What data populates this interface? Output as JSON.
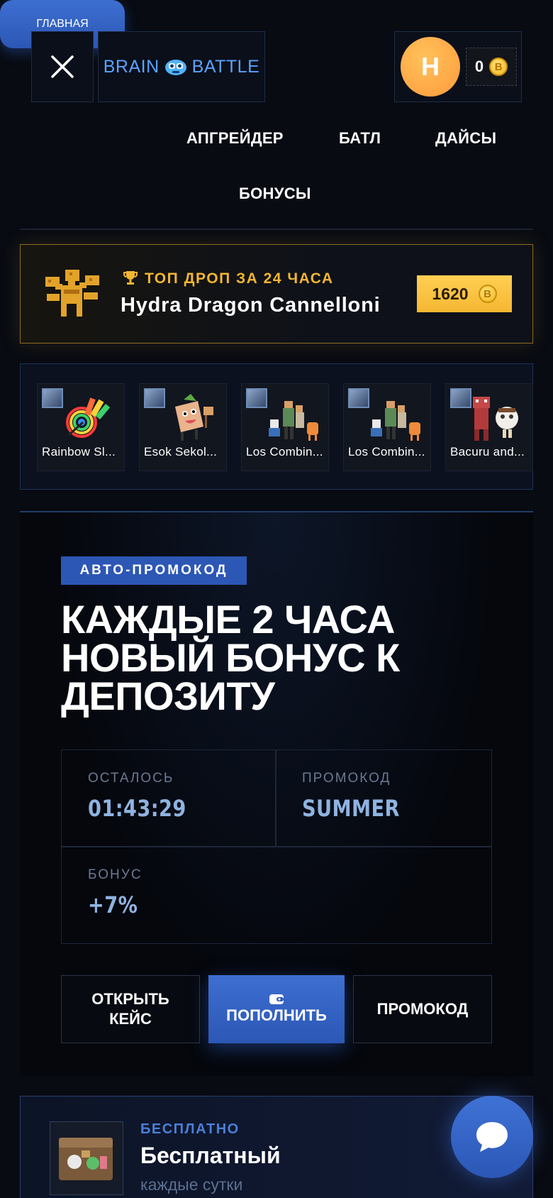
{
  "header": {
    "logo_left": "BRAIN",
    "logo_right": "BATTLE",
    "avatar_letter": "H",
    "balance": "0",
    "coin_symbol": "B"
  },
  "nav": {
    "items": [
      "ГЛАВНАЯ",
      "АПГРЕЙДЕР",
      "БАТЛ",
      "ДАЙСЫ",
      "БОНУСЫ"
    ],
    "active": "ГЛАВНАЯ"
  },
  "top_drop": {
    "label": "ТОП ДРОП ЗА 24 ЧАСА",
    "item_name": "Hydra Dragon Cannelloni",
    "price": "1620",
    "coin_symbol": "B"
  },
  "recent_drops": [
    {
      "name": "Rainbow Sl..."
    },
    {
      "name": "Esok Sekol..."
    },
    {
      "name": "Los Combin..."
    },
    {
      "name": "Los Combin..."
    },
    {
      "name": "Bacuru and..."
    }
  ],
  "promo": {
    "badge": "АВТО-ПРОМОКОД",
    "headline_line1": "КАЖДЫЕ 2 ЧАСА",
    "headline_line2": "НОВЫЙ БОНУС К",
    "headline_line3": "ДЕПОЗИТУ",
    "remaining_label": "ОСТАЛОСЬ",
    "remaining_value": "01:43:29",
    "promocode_label": "ПРОМОКОД",
    "promocode_value": "SUMMER",
    "bonus_label": "БОНУС",
    "bonus_value": "+7%",
    "btn_open_line1": "ОТКРЫТЬ",
    "btn_open_line2": "КЕЙС",
    "btn_deposit": "ПОПОЛНИТЬ",
    "btn_promocode": "ПРОМОКОД"
  },
  "free_case": {
    "tag": "БЕСПЛАТНО",
    "title": "Бесплатный",
    "subtitle": "каждые сутки"
  },
  "colors": {
    "accent": "#2c57b5",
    "gold": "#f6b732",
    "background": "#080b12"
  }
}
